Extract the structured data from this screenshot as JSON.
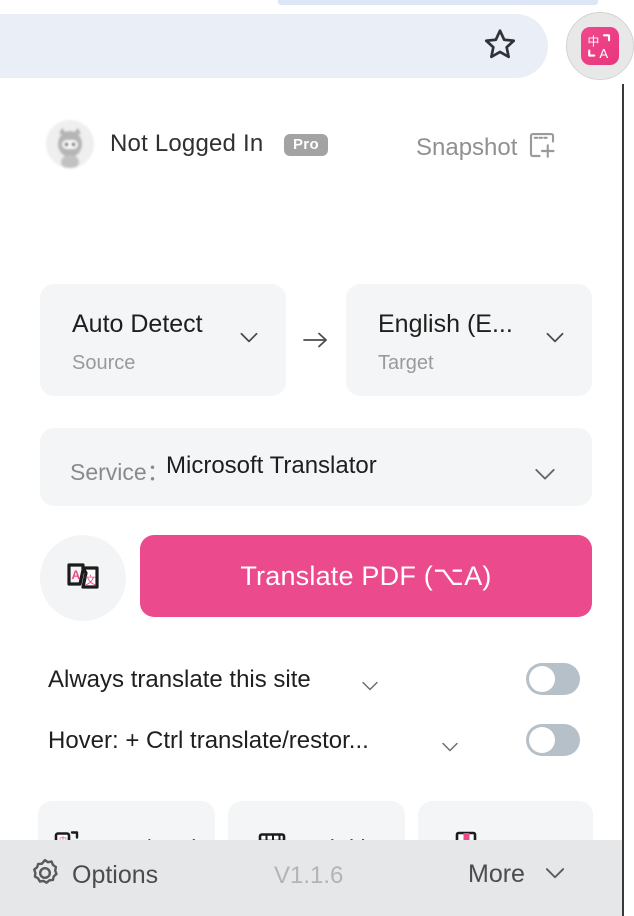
{
  "browser": {
    "bookmark_icon": "star-icon",
    "extension_icon": "translate-extension-icon",
    "extension_icon_glyphs": "中A",
    "extension_icon_color": "#eb4a8d"
  },
  "account": {
    "avatar_icon": "user-avatar",
    "name": "Not Logged In",
    "badge": "Pro",
    "snapshot_label": "Snapshot",
    "snapshot_icon": "snapshot-add-icon"
  },
  "languages": {
    "source": {
      "value": "Auto Detect",
      "sublabel": "Source"
    },
    "arrow": "→",
    "target": {
      "value": "English (E...",
      "sublabel": "Target"
    }
  },
  "service": {
    "label": "Service：",
    "value": "Microsoft Translator"
  },
  "actions": {
    "pdf_icon": "translate-document-icon",
    "translate_label": "Translate PDF (⌥A)"
  },
  "options": {
    "always": {
      "label": "Always translate this site",
      "toggle_on": false
    },
    "hover": {
      "label": "Hover:  + Ctrl translate/restor...",
      "toggle_on": false
    }
  },
  "cards": [
    {
      "label": "PDF/ePub",
      "icon": "pdf-epub-icon"
    },
    {
      "label": "Subtitle",
      "icon": "subtitle-video-icon"
    },
    {
      "label": "Usage",
      "icon": "usage-book-icon"
    }
  ],
  "footer": {
    "options_label": "Options",
    "options_icon": "gear-icon",
    "version": "V1.1.6",
    "more_label": "More",
    "more_icon": "chevron-down-icon"
  },
  "colors": {
    "accent": "#eb4a8d",
    "panel_bg": "#ffffff",
    "field_bg": "#f4f5f6",
    "footer_bg": "#e6e7e9",
    "omnibox_bg": "#eaeef7",
    "toggle_off": "#b6c0c9"
  }
}
